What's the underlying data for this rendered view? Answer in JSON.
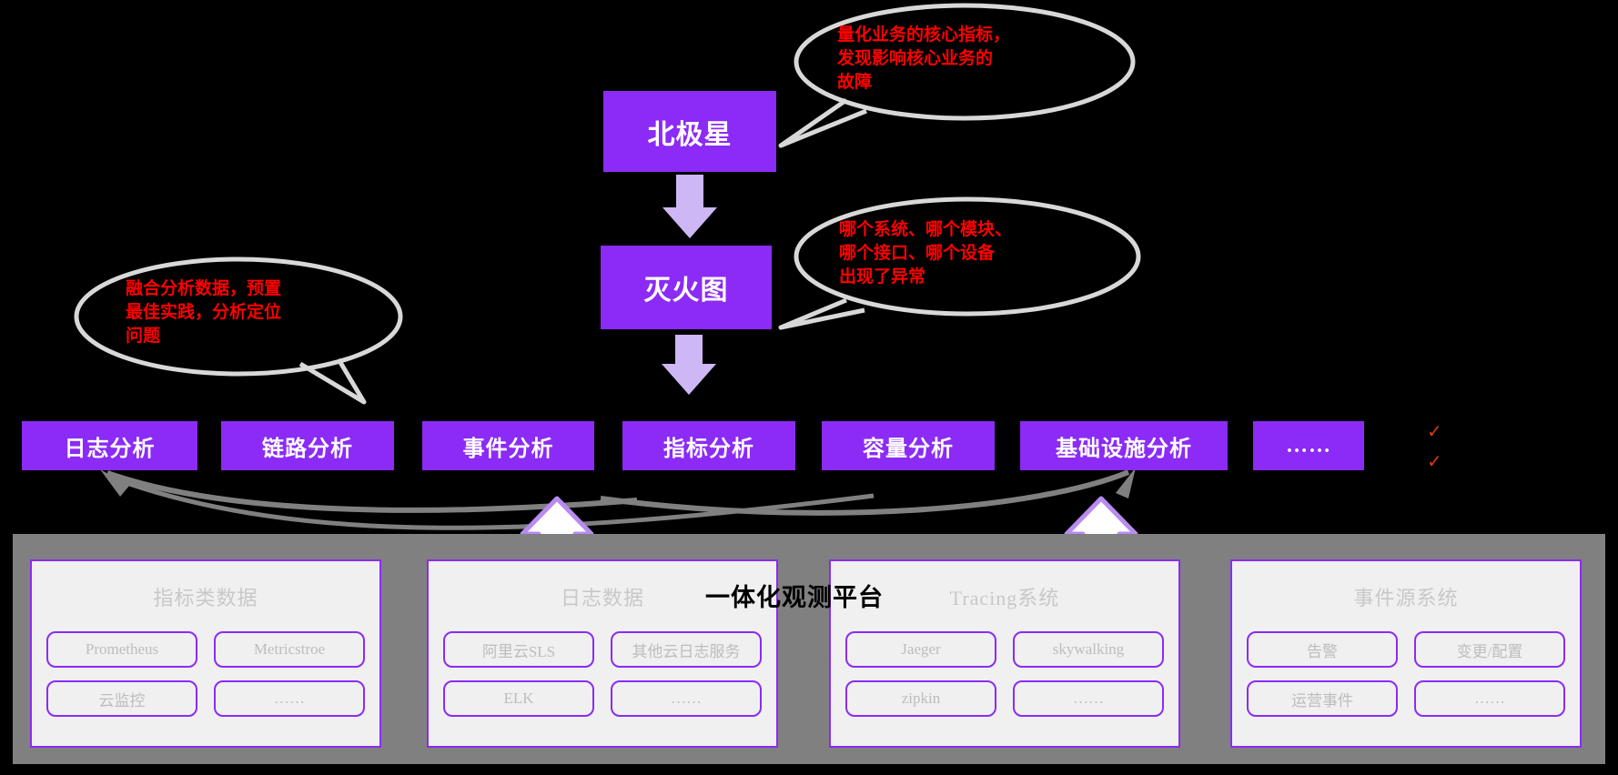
{
  "diagram": {
    "top_nodes": [
      {
        "id": "north-star",
        "label": "北极星"
      },
      {
        "id": "firefight-map",
        "label": "灭火图"
      }
    ],
    "callouts": [
      {
        "id": "north-star-callout",
        "text": "量化业务的核心指标，\n发现影响核心业务的\n故障",
        "color": "#ff0000"
      },
      {
        "id": "firefight-callout",
        "text": "哪个系统、哪个模块、\n哪个接口、哪个设备\n出现了异常",
        "color": "#ff0000"
      },
      {
        "id": "analysis-callout",
        "text": "融合分析数据，预置\n最佳实践，分析定位\n问题",
        "color": "#ff0000"
      }
    ],
    "analysis_boxes": [
      {
        "label": "日志分析"
      },
      {
        "label": "链路分析"
      },
      {
        "label": "事件分析"
      },
      {
        "label": "指标分析"
      },
      {
        "label": "容量分析"
      },
      {
        "label": "基础设施分析"
      },
      {
        "label": "……"
      }
    ],
    "checkmarks": [
      "✓",
      "✓"
    ],
    "platform": {
      "title": "一体化观测平台",
      "panels": [
        {
          "title": "指标类数据",
          "items": [
            "Prometheus",
            "Metricstroe",
            "云监控",
            "……"
          ]
        },
        {
          "title": "日志数据",
          "items": [
            "阿里云SLS",
            "其他云日志服务",
            "ELK",
            "……"
          ]
        },
        {
          "title": "Tracing系统",
          "items": [
            "Jaeger",
            "skywalking",
            "zipkin",
            "……"
          ]
        },
        {
          "title": "事件源系统",
          "items": [
            "告警",
            "变更/配置",
            "运营事件",
            "……"
          ]
        }
      ]
    },
    "colors": {
      "box_purple": "#8b2bf5",
      "platform_gray": "#808080",
      "panel_bg": "#f0f0f0",
      "callout_red": "#ff0000",
      "arrow_gray": "#808080",
      "bubble_stroke": "#d8d8d8",
      "light_arrow": "#cdb8f5"
    }
  }
}
